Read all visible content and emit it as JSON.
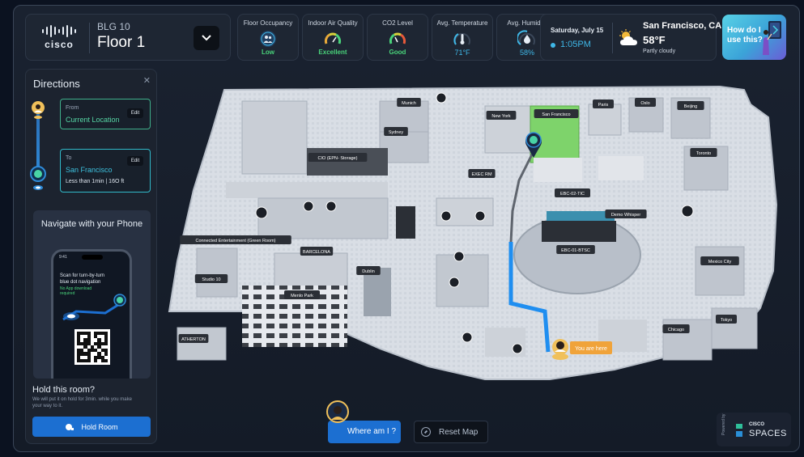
{
  "header": {
    "brand": "cisco",
    "building": "BLG 10",
    "floor": "Floor 1"
  },
  "metrics": [
    {
      "label": "Floor Occupancy",
      "value": "Low",
      "color": "#49d37a",
      "icon": "people-icon"
    },
    {
      "label": "Indoor Air Quality",
      "value": "Excellent",
      "color": "#49d37a",
      "icon": "gauge-icon"
    },
    {
      "label": "CO2 Level",
      "value": "Good",
      "color": "#49d37a",
      "icon": "gauge-icon"
    },
    {
      "label": "Avg. Temperature",
      "value": "71°F",
      "color": "#3fb8e8",
      "icon": "thermometer-icon"
    },
    {
      "label": "Avg. Humidity",
      "value": "58%",
      "color": "#3fb8e8",
      "icon": "droplet-icon"
    }
  ],
  "datetime": {
    "date": "Saturday, July 15",
    "time": "1:05PM"
  },
  "weather": {
    "city": "San Francisco, CA",
    "temperature": "58°F",
    "condition": "Partly cloudy",
    "icon": "partly-cloudy-icon"
  },
  "help": {
    "label": "How do I use this?"
  },
  "directions": {
    "title": "Directions",
    "from_label": "From",
    "from_value": "Current Location",
    "to_label": "To",
    "to_value": "San Francisco",
    "to_detail": "Less than 1min  |  16O ft",
    "edit_label": "Edit",
    "nav_title": "Navigate with your Phone",
    "phone_time": "9:41",
    "phone_message": "Scan for turn-by-turn blue dot navigation",
    "phone_sub": "No App download required",
    "hold_title": "Hold this room?",
    "hold_sub": "We will put it on hold for 3min. while you make your way to it.",
    "hold_button": "Hold Room"
  },
  "map": {
    "rooms": [
      {
        "name": "Munich"
      },
      {
        "name": "Sydney"
      },
      {
        "name": "New York"
      },
      {
        "name": "San Francisco"
      },
      {
        "name": "Paris"
      },
      {
        "name": "Oslo"
      },
      {
        "name": "Beijing"
      },
      {
        "name": "Toronto"
      },
      {
        "name": "CIO (EPN- Storage)"
      },
      {
        "name": "EXEC RM"
      },
      {
        "name": "EBC-02-TIC"
      },
      {
        "name": "Demo Whisper"
      },
      {
        "name": "EBC-01-BTSC"
      },
      {
        "name": "Connected Entertainment (Green Room)"
      },
      {
        "name": "BARCELONA"
      },
      {
        "name": "Studio 10"
      },
      {
        "name": "Menlo Park"
      },
      {
        "name": "Dublin"
      },
      {
        "name": "Mexico City"
      },
      {
        "name": "Chicago"
      },
      {
        "name": "Tokyo"
      },
      {
        "name": "ATHERTON"
      }
    ],
    "you_are_here": "You are here",
    "route_color": "#1f8ef0",
    "destination_color": "#7ed36b"
  },
  "controls": {
    "where_am_i": "Where am I ?",
    "reset_map": "Reset Map"
  },
  "footer": {
    "powered_by": "Powered by",
    "brand_top": "CISCO",
    "brand_bottom": "SPACES"
  }
}
